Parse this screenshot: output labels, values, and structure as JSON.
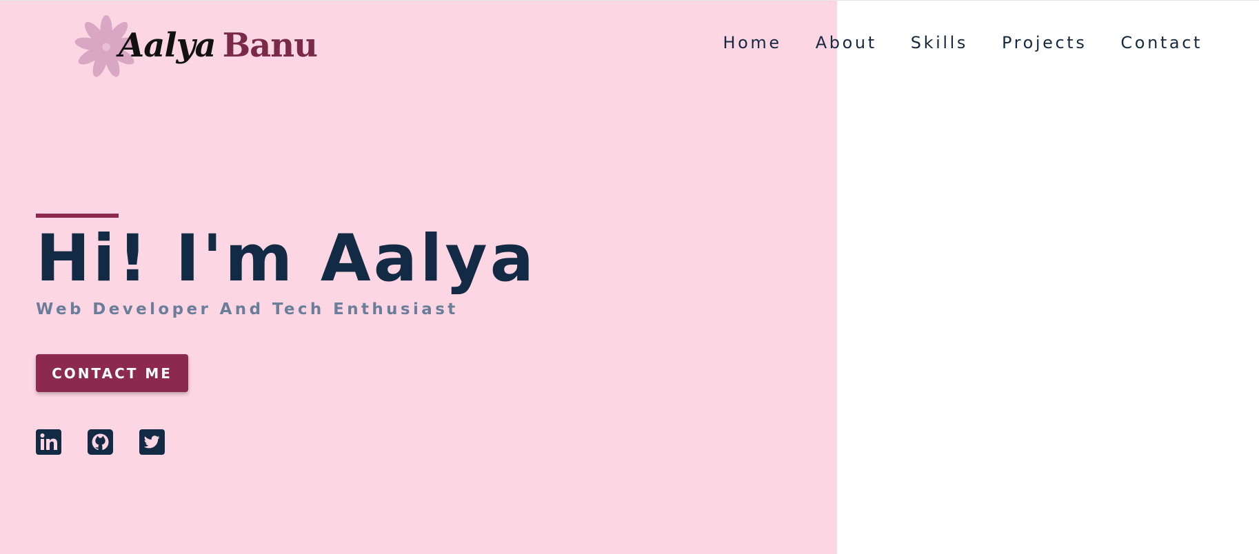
{
  "colors": {
    "pink_background": "#fcd7e3",
    "accent": "#8b2a4e",
    "navy": "#132a45",
    "subtitle": "#6a7e99",
    "logo_flower": "#d9a6c4",
    "white": "#ffffff"
  },
  "header": {
    "logo": {
      "first_name": "Aalya",
      "last_name": "Banu",
      "icon": "flower-icon"
    },
    "nav": [
      {
        "label": "Home"
      },
      {
        "label": "About"
      },
      {
        "label": "Skills"
      },
      {
        "label": "Projects"
      },
      {
        "label": "Contact"
      }
    ]
  },
  "hero": {
    "title": "Hi! I'm Aalya",
    "subtitle": "Web Developer And Tech Enthusiast",
    "cta_label": "CONTACT ME",
    "socials": [
      {
        "name": "LinkedIn",
        "icon": "linkedin-icon"
      },
      {
        "name": "GitHub",
        "icon": "github-icon"
      },
      {
        "name": "Twitter",
        "icon": "twitter-icon"
      }
    ]
  }
}
